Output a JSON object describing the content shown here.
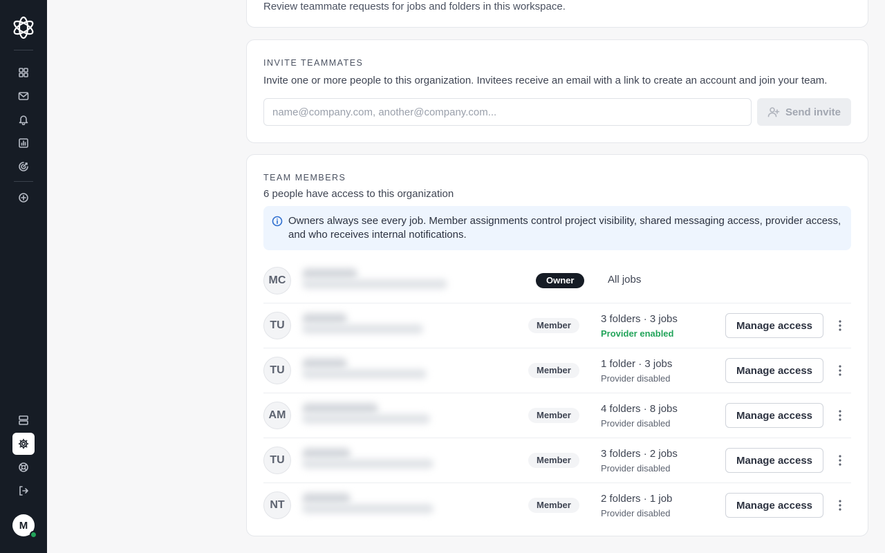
{
  "header_card": {
    "description": "Review teammate requests for jobs and folders in this workspace."
  },
  "invite": {
    "title": "INVITE TEAMMATES",
    "description": "Invite one or more people to this organization. Invitees receive an email with a link to create an account and join your team.",
    "placeholder": "name@company.com, another@company.com...",
    "value": "",
    "send_label": "Send invite"
  },
  "team": {
    "title": "TEAM MEMBERS",
    "subtitle": "6 people have access to this organization",
    "info": "Owners always see every job. Member assignments control project visibility, shared messaging access, provider access, and who receives internal notifications.",
    "members": [
      {
        "initials": "MC",
        "role": "Owner",
        "access": "All jobs"
      },
      {
        "initials": "TU",
        "role": "Member",
        "access": "3 folders · 3 jobs",
        "provider": "Provider enabled",
        "manage": "Manage access"
      },
      {
        "initials": "TU",
        "role": "Member",
        "access": "1 folder · 3 jobs",
        "provider": "Provider disabled",
        "manage": "Manage access"
      },
      {
        "initials": "AM",
        "role": "Member",
        "access": "4 folders · 8 jobs",
        "provider": "Provider disabled",
        "manage": "Manage access"
      },
      {
        "initials": "TU",
        "role": "Member",
        "access": "3 folders · 2 jobs",
        "provider": "Provider disabled",
        "manage": "Manage access"
      },
      {
        "initials": "NT",
        "role": "Member",
        "access": "2 folders · 1 job",
        "provider": "Provider disabled",
        "manage": "Manage access"
      }
    ]
  },
  "sidebar": {
    "user_initial": "M",
    "icons": [
      "grid-icon",
      "mail-icon",
      "bell-icon",
      "chart-icon",
      "target-icon",
      "plus-circle-icon",
      "database-icon",
      "gear-icon",
      "lifebuoy-icon",
      "logout-icon"
    ]
  },
  "colors": {
    "sidebar_bg": "#161c25",
    "provider_enabled": "#22a45a",
    "info_bg": "#eef5fe",
    "info_icon": "#2f6fcf"
  }
}
